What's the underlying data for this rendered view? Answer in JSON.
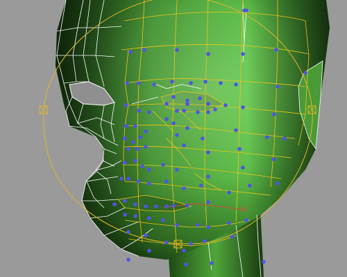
{
  "viewport": {
    "background": "#9a9a9a",
    "view": "3d-perspective-viewport",
    "subject": "head-mesh"
  },
  "mesh": {
    "shading": "smooth",
    "surface_color": "#5fbf4a",
    "shadow_color": "#0f2a08",
    "wireframe_color": "#ffffff",
    "selected_edge_color": "#f0c419",
    "vertex_color": "#4f55e6",
    "soft_selection_color": "#d64a3a"
  },
  "gizmo": {
    "ring_color": "#e2b62a",
    "handle_icon": "square-x-handle-icon"
  }
}
